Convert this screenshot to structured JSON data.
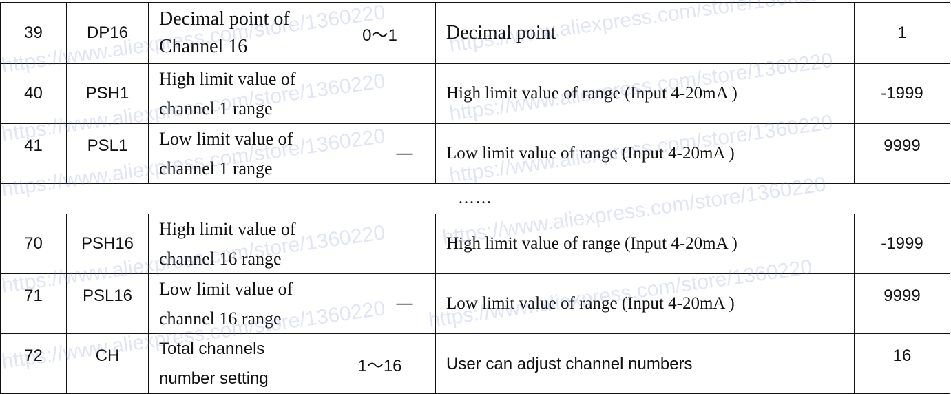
{
  "watermark": "https://www.aliexpress.com/store/1360220",
  "rows": [
    {
      "no": "39",
      "code": "DP16",
      "name": "Decimal point of Channel 16",
      "range": "0～1",
      "desc": "Decimal point",
      "default": "1"
    },
    {
      "no": "40",
      "code": "PSH1",
      "name": "High limit value of channel 1 range",
      "range": "",
      "desc": "High limit value of range (Input 4-20mA )",
      "default": "-1999"
    },
    {
      "no": "41",
      "code": "PSL1",
      "name": "Low limit value of channel 1 range",
      "range": "—",
      "desc": "Low limit value of range (Input 4-20mA )",
      "default": "9999"
    },
    {
      "ellipsis": "……"
    },
    {
      "no": "70",
      "code": "PSH16",
      "name": "High limit value of channel 16 range",
      "range": "",
      "desc": "High limit value of range (Input 4-20mA )",
      "default": "-1999"
    },
    {
      "no": "71",
      "code": "PSL16",
      "name": "Low limit value of channel 16 range",
      "range": "—",
      "desc": "Low limit value of range (Input 4-20mA )",
      "default": "9999"
    },
    {
      "no": "72",
      "code": "CH",
      "name": "Total channels number setting",
      "range": "1～16",
      "desc": "User can adjust channel numbers",
      "default": "16"
    }
  ]
}
